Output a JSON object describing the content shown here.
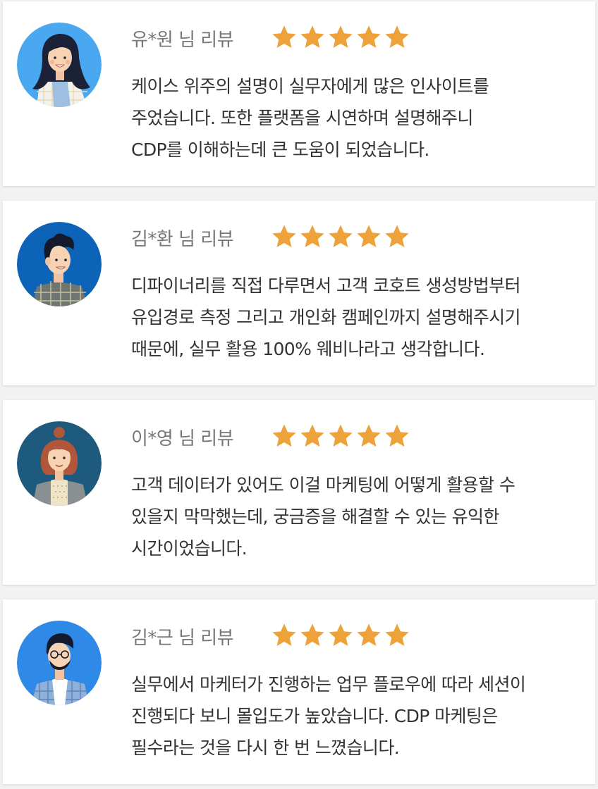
{
  "reviews": [
    {
      "reviewer": "유*원 님 리뷰",
      "rating": 5,
      "avatar_icon": "woman-long-hair-avatar-icon",
      "avatar_bg": "#4aa8f0",
      "lines": [
        "케이스 위주의 설명이 실무자에게 많은 인사이트를",
        "주었습니다. 또한 플랫폼을 시연하며 설명해주니",
        "CDP를 이해하는데 큰 도움이 되었습니다."
      ]
    },
    {
      "reviewer": "김*환 님 리뷰",
      "rating": 5,
      "avatar_icon": "man-curly-hair-avatar-icon",
      "avatar_bg": "#0d63b8",
      "lines": [
        "디파이너리를 직접 다루면서 고객 코호트 생성방법부터",
        "유입경로 측정 그리고 개인화 캠페인까지 설명해주시기",
        "때문에, 실무 활용 100% 웨비나라고 생각합니다."
      ]
    },
    {
      "reviewer": "이*영 님 리뷰",
      "rating": 5,
      "avatar_icon": "woman-bun-hair-avatar-icon",
      "avatar_bg": "#1e5a7e",
      "lines": [
        "고객 데이터가 있어도 이걸 마케팅에 어떻게 활용할 수",
        "있을지 막막했는데, 궁금증을 해결할 수 있는 유익한",
        "시간이었습니다."
      ]
    },
    {
      "reviewer": "김*근 님 리뷰",
      "rating": 5,
      "avatar_icon": "man-glasses-avatar-icon",
      "avatar_bg": "#2e8ae6",
      "lines": [
        "실무에서 마케터가 진행하는 업무 플로우에 따라 세션이",
        "진행되다 보니 몰입도가 높았습니다. CDP 마케팅은",
        "필수라는 것을 다시 한 번 느꼈습니다."
      ]
    }
  ],
  "colors": {
    "star": "#eea23a",
    "name_text": "#777777",
    "body_text": "#333333",
    "card_bg": "#ffffff",
    "page_bg": "#f2f2f2"
  }
}
